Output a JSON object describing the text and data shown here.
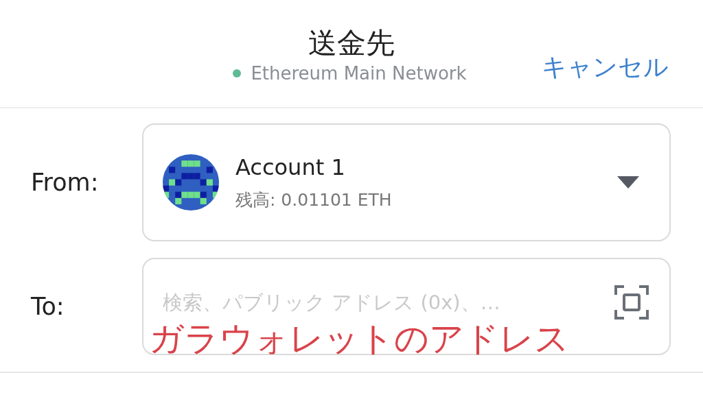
{
  "header": {
    "title": "送金先",
    "network": "Ethereum Main Network",
    "cancel": "キャンセル"
  },
  "from": {
    "label": "From:",
    "account": "Account 1",
    "balance": "残高: 0.01101 ETH"
  },
  "to": {
    "label": "To:",
    "placeholder": "検索、パブリック アドレス (0x)、…",
    "annotation": "ガラウォレットのアドレス"
  }
}
